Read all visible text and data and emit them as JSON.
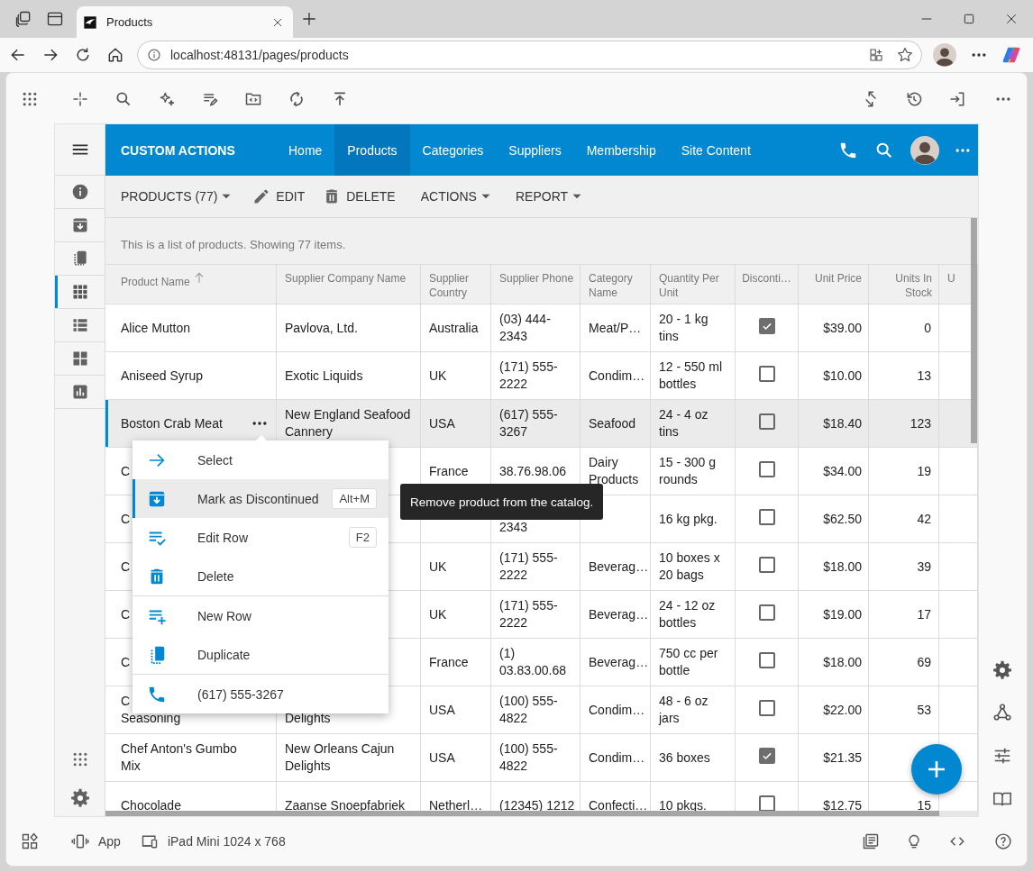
{
  "browser": {
    "tab_title": "Products",
    "url": "localhost:48131/pages/products"
  },
  "app": {
    "brand": "CUSTOM ACTIONS",
    "nav": [
      {
        "label": "Home",
        "selected": false
      },
      {
        "label": "Products",
        "selected": true
      },
      {
        "label": "Categories",
        "selected": false
      },
      {
        "label": "Suppliers",
        "selected": false
      },
      {
        "label": "Membership",
        "selected": false
      },
      {
        "label": "Site Content",
        "selected": false
      }
    ],
    "sidebar": {
      "items": [
        {
          "selected": false
        },
        {
          "selected": false
        },
        {
          "selected": false
        },
        {
          "selected": true
        },
        {
          "selected": false
        },
        {
          "selected": false
        },
        {
          "selected": false
        }
      ]
    },
    "toolbar": [
      {
        "label": "PRODUCTS (77)",
        "kind": "dropdown"
      },
      {
        "label": "EDIT",
        "kind": "edit"
      },
      {
        "label": "DELETE",
        "kind": "delete"
      },
      {
        "label": "ACTIONS",
        "kind": "dropdown"
      },
      {
        "label": "REPORT",
        "kind": "dropdown"
      }
    ],
    "description": "This is a list of products. Showing 77 items.",
    "table": {
      "columns": [
        {
          "label": "Product Name",
          "kind": "text",
          "sorted": true
        },
        {
          "label": "Supplier Company Name",
          "kind": "text"
        },
        {
          "label": "Supplier Country",
          "kind": "text"
        },
        {
          "label": "Supplier Phone",
          "kind": "text"
        },
        {
          "label": "Category Name",
          "kind": "text"
        },
        {
          "label": "Quantity Per Unit",
          "kind": "text"
        },
        {
          "label": "Disconti…",
          "kind": "checkbox"
        },
        {
          "label": "Unit Price",
          "kind": "number"
        },
        {
          "label": "Units In Stock",
          "kind": "number"
        },
        {
          "label": "U",
          "kind": "text"
        }
      ],
      "rows": [
        {
          "selected": false,
          "cells": [
            "Alice Mutton",
            "Pavlova, Ltd.",
            "Australia",
            "(03) 444-2343",
            "Meat/P…",
            "20 - 1 kg tins",
            true,
            "$39.00",
            "0",
            null
          ]
        },
        {
          "selected": false,
          "cells": [
            "Aniseed Syrup",
            "Exotic Liquids",
            "UK",
            "(171) 555-2222",
            "Condim…",
            "12 - 550 ml bottles",
            false,
            "$10.00",
            "13",
            null
          ]
        },
        {
          "selected": true,
          "cells": [
            "Boston Crab Meat",
            "New England Seafood Cannery",
            "USA",
            "(617) 555-3267",
            "Seafood",
            "24 - 4 oz tins",
            false,
            "$18.40",
            "123",
            null
          ]
        },
        {
          "selected": false,
          "cells": [
            "C",
            null,
            "France",
            "38.76.98.06",
            "Dairy Products",
            "15 - 300 g rounds",
            false,
            "$34.00",
            "19",
            null
          ]
        },
        {
          "selected": false,
          "cells": [
            "C",
            null,
            null,
            "\n2343",
            null,
            "16 kg pkg.",
            false,
            "$62.50",
            "42",
            null
          ]
        },
        {
          "selected": false,
          "cells": [
            "C",
            null,
            "UK",
            "(171) 555-2222",
            "Beverag…",
            "10 boxes x 20 bags",
            false,
            "$18.00",
            "39",
            null
          ]
        },
        {
          "selected": false,
          "cells": [
            "C",
            null,
            "UK",
            "(171) 555-2222",
            "Beverag…",
            "24 - 12 oz bottles",
            false,
            "$19.00",
            "17",
            null
          ]
        },
        {
          "selected": false,
          "cells": [
            "C",
            null,
            "France",
            "(1) 03.83.00.68",
            "Beverag…",
            "750 cc per bottle",
            false,
            "$18.00",
            "69",
            null
          ]
        },
        {
          "selected": false,
          "cells": [
            "C\nSeasoning",
            "\nDelights",
            "USA",
            "(100) 555-4822",
            "Condim…",
            "48 - 6 oz jars",
            false,
            "$22.00",
            "53",
            null
          ]
        },
        {
          "selected": false,
          "cells": [
            "Chef Anton's Gumbo Mix",
            "New Orleans Cajun Delights",
            "USA",
            "(100) 555-4822",
            "Condim…",
            "36 boxes",
            true,
            "$21.35",
            null,
            null
          ]
        },
        {
          "selected": false,
          "cells": [
            "Chocolade",
            "Zaanse Snoepfabriek",
            "Netherl…",
            "(12345) 1212",
            "Confecti…",
            "10 pkgs.",
            false,
            "$12.75",
            "15",
            null
          ]
        }
      ]
    },
    "context_menu": {
      "groups": [
        [
          {
            "label": "Select",
            "selected": false
          },
          {
            "label": "Mark as Discontinued",
            "selected": true,
            "shortcut": "Alt+M"
          },
          {
            "label": "Edit Row",
            "selected": false,
            "shortcut": "F2"
          },
          {
            "label": "Delete",
            "selected": false
          }
        ],
        [
          {
            "label": "New Row",
            "selected": false
          },
          {
            "label": "Duplicate",
            "selected": false
          }
        ],
        [
          {
            "label": "(617) 555-3267",
            "selected": false
          }
        ]
      ]
    },
    "tooltip": "Remove product from the catalog."
  },
  "designer": {
    "status_bar": [
      "App",
      "iPad Mini 1024 x 768"
    ]
  }
}
